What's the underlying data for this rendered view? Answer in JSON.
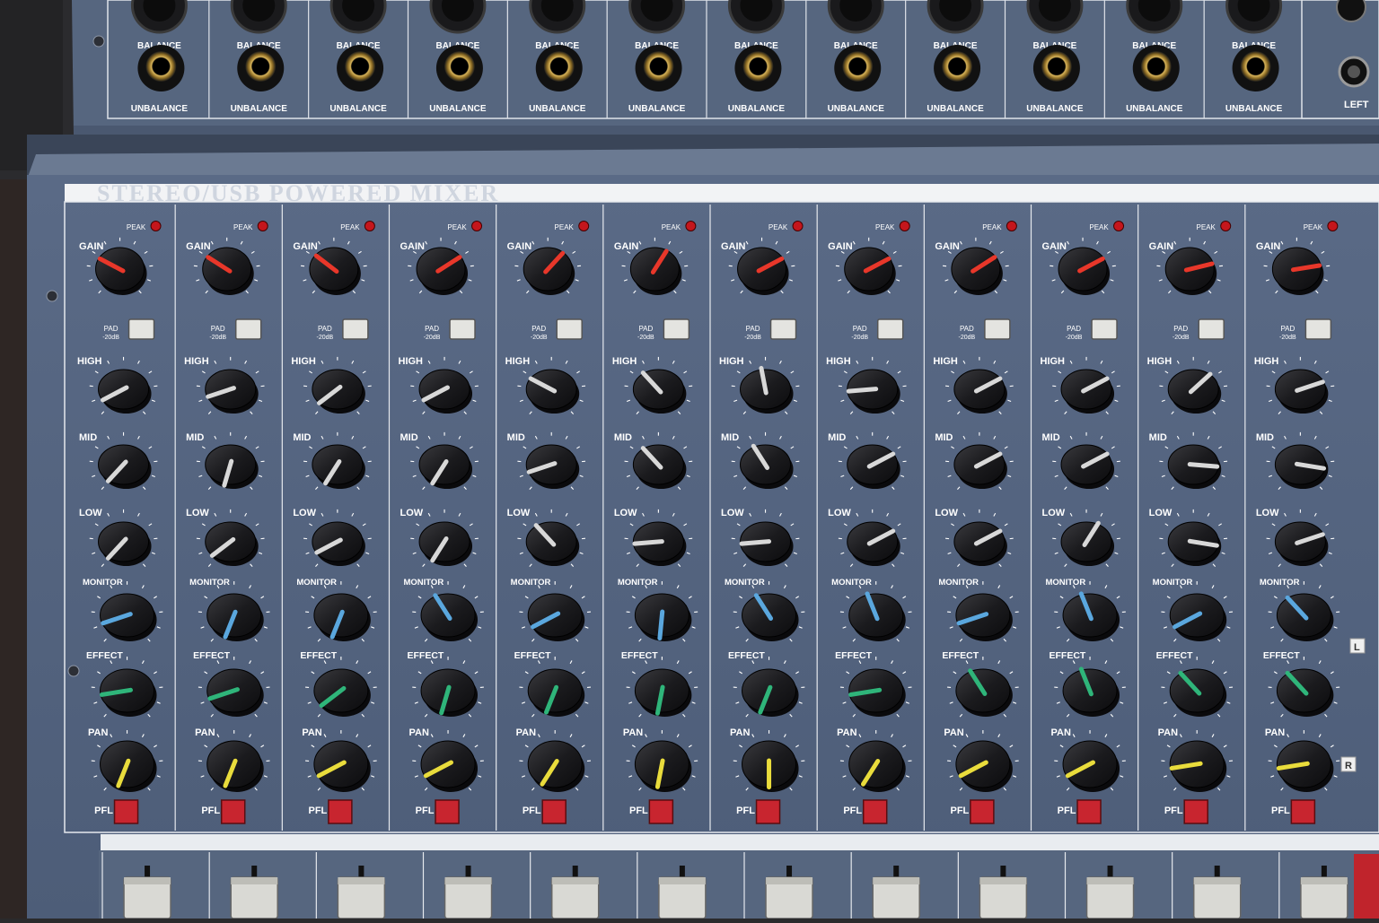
{
  "mixer": {
    "title": "STEREO/USB POWERED MIXER",
    "input_labels": {
      "balance": "BALANCE",
      "unbalance": "UNBALANCE"
    },
    "channel_labels": {
      "gain": "GAIN",
      "peak": "PEAK",
      "pad": "PAD",
      "pad_value": "-20dB",
      "high": "HIGH",
      "mid": "MID",
      "low": "LOW",
      "monitor": "MONITOR",
      "effect": "EFFECT",
      "pan": "PAN",
      "pfl": "PFL"
    },
    "right_input_label": "LEFT",
    "bus_labels": {
      "left": "L",
      "right": "R"
    },
    "channel_count": 12,
    "knob_colors": {
      "gain": "#e8372a",
      "eq": "#d8d8d8",
      "monitor": "#5aa7de",
      "effect": "#2fb57a",
      "pan": "#e9dc3c"
    },
    "peak_led_color": "#c4161c",
    "pfl_button_color": "#c8252f"
  }
}
